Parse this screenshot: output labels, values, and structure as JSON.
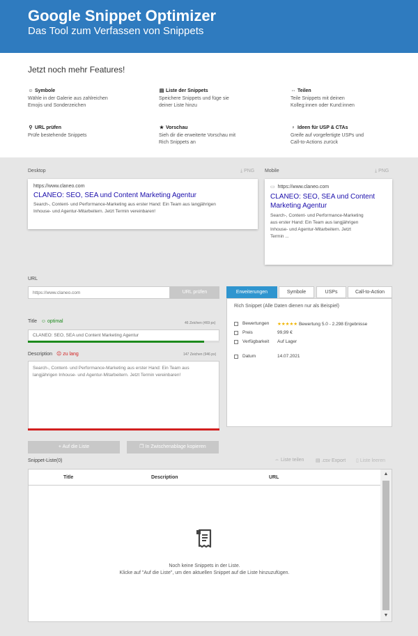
{
  "header": {
    "title": "Google Snippet Optimizer",
    "subtitle": "Das Tool zum Verfassen von Snippets"
  },
  "features": {
    "title": "Jetzt noch mehr Features!",
    "items": [
      {
        "icon": "smiley-icon",
        "heading": "Symbole",
        "line1": "Wähle in der Galerie aus zahlreichen",
        "line2": "Emojis und Sonderzeichen"
      },
      {
        "icon": "list-icon",
        "heading": "Liste der Snippets",
        "line1": "Speichere Snippets und füge sie",
        "line2": "deiner Liste hinzu"
      },
      {
        "icon": "share-icon",
        "heading": "Teilen",
        "line1": "Teile Snippets mit deinen",
        "line2": "Kolleg:innen oder Kund:innen"
      },
      {
        "icon": "search-icon",
        "heading": "URL prüfen",
        "line1": "Prüfe bestehende Snippets",
        "line2": ""
      },
      {
        "icon": "star-icon",
        "heading": "Vorschau",
        "line1": "Sieh dir die erweiterte Vorschau mit",
        "line2": "Rich Snippets an"
      },
      {
        "icon": "lightbulb-icon",
        "heading": "Ideen für USP & CTAs",
        "line1": "Greife auf vorgefertigte USPs und",
        "line2": "Call-to-Actions zurück"
      }
    ]
  },
  "preview": {
    "desktop_label": "Desktop",
    "mobile_label": "Mobile",
    "png_label": "PNG",
    "url": "https://www.claneo.com",
    "title": "CLANEO: SEO, SEA und Content Marketing Agentur",
    "desc_line1": "Search-, Content- und Performance-Marketing aus erster Hand: Ein Team aus langjährigen",
    "desc_line2": "Inhouse- und Agentur-Mitarbeitern. Jetzt Termin vereinbaren!",
    "mobile_title_line1": "CLANEO: SEO, SEA und Content",
    "mobile_title_line2": "Marketing Agentur",
    "mobile_desc_line1": "Search-, Content- und Performance-Marketing",
    "mobile_desc_line2": "aus erster Hand: Ein Team aus langjährigen",
    "mobile_desc_line3": "Inhouse- und Agentur-Mitarbeitern. Jetzt",
    "mobile_desc_line4": "Termin ..."
  },
  "editor": {
    "url_label": "URL",
    "url_placeholder": "https://www.claneo.com",
    "url_check_button": "URL prüfen",
    "title_label": "Title",
    "title_status": "optimal",
    "title_count": "46 Zeichen (469 px)",
    "title_value": "CLANEO: SEO, SEA und Content Marketing Agentur",
    "title_progress": 0.92,
    "desc_label": "Description",
    "desc_status": "zu lang",
    "desc_count": "147 Zeichen (946 px)",
    "desc_line1": "Search-, Content- und Performance-Marketing aus erster Hand: Ein Team aus",
    "desc_line2": "langjährigen Inhouse- und Agentur-Mitarbeitern. Jetzt Termin vereinbaren!",
    "desc_progress": 1.0,
    "add_button": "Auf die Liste",
    "copy_button": "In Zwischenablage kopieren"
  },
  "extensions": {
    "tabs": [
      "Erweiterungen",
      "Symbole",
      "USPs",
      "Call-to-Action"
    ],
    "active_tab": 0,
    "note": "Rich Snippet (Alle Daten dienen nur als Beispiel)",
    "rows": [
      {
        "label": "Bewertungen",
        "stars": "★★★★★",
        "value": "Bewertung 5.0 - 2.298 Ergebnisse"
      },
      {
        "label": "Preis",
        "value": "99,99 €"
      },
      {
        "label": "Verfügbarkeit",
        "value": "Auf Lager"
      },
      {
        "label": "Datum",
        "value": "14.07.2021"
      }
    ]
  },
  "snippet_list": {
    "title": "Snippet-Liste",
    "count": "(0)",
    "share_label": "Liste teilen",
    "export_label": ".csv Export",
    "clear_label": "Liste leeren",
    "columns": [
      "Title",
      "Description",
      "URL"
    ],
    "empty_line1": "Noch keine Snippets in der Liste.",
    "empty_line2": "Klicke auf \"Auf die Liste\", um den aktuellen Snippet auf die Liste hinzuzufügen."
  },
  "colors": {
    "header_bg": "#2f7bbf",
    "tab_active": "#2f95cf",
    "ok_green": "#1c8a1c",
    "bad_red": "#d21f1f",
    "link_blue": "#1a0dab"
  }
}
